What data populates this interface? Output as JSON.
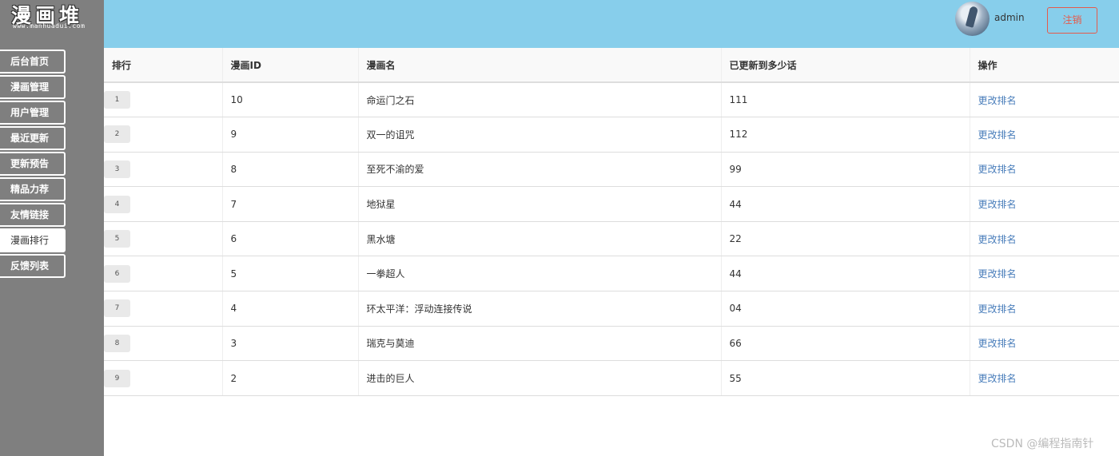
{
  "logo": {
    "title": "漫画堆",
    "url": "www.manhuadui.com"
  },
  "sidebar": {
    "items": [
      {
        "label": "后台首页",
        "active": false
      },
      {
        "label": "漫画管理",
        "active": false
      },
      {
        "label": "用户管理",
        "active": false
      },
      {
        "label": "最近更新",
        "active": false
      },
      {
        "label": "更新预告",
        "active": false
      },
      {
        "label": "精品力荐",
        "active": false
      },
      {
        "label": "友情链接",
        "active": false
      },
      {
        "label": "漫画排行",
        "active": true
      },
      {
        "label": "反馈列表",
        "active": false
      }
    ]
  },
  "header": {
    "username": "admin",
    "logout_label": "注销",
    "avatar_icon": "user-avatar-icon",
    "bg_color": "#87ceeb"
  },
  "table": {
    "columns": [
      "排行",
      "漫画ID",
      "漫画名",
      "已更新到多少话",
      "操作"
    ],
    "rows": [
      {
        "rank": "1",
        "id": "10",
        "name": "命运门之石",
        "episodes": "111",
        "action": "更改排名"
      },
      {
        "rank": "2",
        "id": "9",
        "name": "双一的诅咒",
        "episodes": "112",
        "action": "更改排名"
      },
      {
        "rank": "3",
        "id": "8",
        "name": "至死不渝的爱",
        "episodes": "99",
        "action": "更改排名"
      },
      {
        "rank": "4",
        "id": "7",
        "name": "地狱星",
        "episodes": "44",
        "action": "更改排名"
      },
      {
        "rank": "5",
        "id": "6",
        "name": "黑水塘",
        "episodes": "22",
        "action": "更改排名"
      },
      {
        "rank": "6",
        "id": "5",
        "name": "一拳超人",
        "episodes": "44",
        "action": "更改排名"
      },
      {
        "rank": "7",
        "id": "4",
        "name": "环太平洋：浮动连接传说",
        "episodes": "04",
        "action": "更改排名"
      },
      {
        "rank": "8",
        "id": "3",
        "name": "瑞克与莫迪",
        "episodes": "66",
        "action": "更改排名"
      },
      {
        "rank": "9",
        "id": "2",
        "name": "进击的巨人",
        "episodes": "55",
        "action": "更改排名"
      }
    ]
  },
  "watermark": "CSDN @编程指南针"
}
